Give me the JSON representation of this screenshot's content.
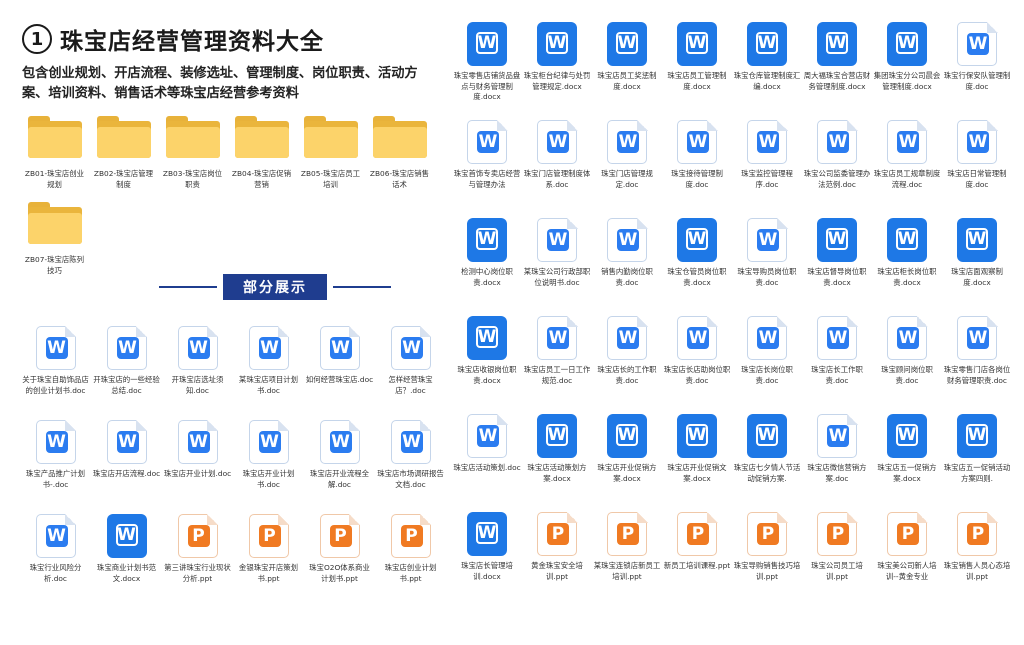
{
  "header": {
    "number": "1",
    "title": "珠宝店经营管理资料大全",
    "description": "包含创业规划、开店流程、装修选址、管理制度、岗位职责、活动方案、培训资料、销售话术等珠宝店经营参考资料"
  },
  "folders": [
    {
      "label": "ZB01-珠宝店创业规划"
    },
    {
      "label": "ZB02-珠宝店管理制度"
    },
    {
      "label": "ZB03-珠宝店岗位职责"
    },
    {
      "label": "ZB04-珠宝店促销营销"
    },
    {
      "label": "ZB05-珠宝店员工培训"
    },
    {
      "label": "ZB06-珠宝店销售话术"
    },
    {
      "label": "ZB07-珠宝店陈列技巧"
    }
  ],
  "section": {
    "label": "部分展示"
  },
  "left_files": [
    {
      "type": "wps",
      "label": "关于珠宝自助饰品店的创业计划书.doc"
    },
    {
      "type": "wps",
      "label": "开珠宝店的一些经验总结.doc"
    },
    {
      "type": "wps",
      "label": "开珠宝店选址须知.doc"
    },
    {
      "type": "wps",
      "label": "某珠宝店项目计划书.doc"
    },
    {
      "type": "wps",
      "label": "如何经营珠宝店.doc"
    },
    {
      "type": "wps",
      "label": "怎样经营珠宝店？.doc"
    },
    {
      "type": "wps",
      "label": "珠宝产品推广计划书-.doc"
    },
    {
      "type": "wps",
      "label": "珠宝店开店流程.doc"
    },
    {
      "type": "wps",
      "label": "珠宝店开业计划.doc"
    },
    {
      "type": "wps",
      "label": "珠宝店开业计划书.doc"
    },
    {
      "type": "wps",
      "label": "珠宝店开业流程全解.doc"
    },
    {
      "type": "wps",
      "label": "珠宝店市场调研报告文档.doc"
    },
    {
      "type": "wps",
      "label": "珠宝行业风险分析.doc"
    },
    {
      "type": "word",
      "label": "珠宝商业计划书范文.docx"
    },
    {
      "type": "ppt",
      "label": "第三讲珠宝行业现状分析.ppt"
    },
    {
      "type": "ppt",
      "label": "金银珠宝开店策划书.ppt"
    },
    {
      "type": "ppt",
      "label": "珠宝O2O体系商业计划书.ppt"
    },
    {
      "type": "ppt",
      "label": "珠宝店创业计划书.ppt"
    }
  ],
  "right_files": [
    {
      "type": "word",
      "label": "珠宝零售店铺货品盘点与财务管理制度.docx"
    },
    {
      "type": "word",
      "label": "珠宝柜台纪律与处罚管理规定.docx"
    },
    {
      "type": "word",
      "label": "珠宝店员工奖惩制度.docx"
    },
    {
      "type": "word",
      "label": "珠宝店员工管理制度.docx"
    },
    {
      "type": "word",
      "label": "珠宝仓库管理制度汇编.docx"
    },
    {
      "type": "word",
      "label": "周大福珠宝合营店财务管理制度.docx"
    },
    {
      "type": "word",
      "label": "集团珠宝分公司晨会管理制度.docx"
    },
    {
      "type": "wps",
      "label": "珠宝行保安队管理制度.doc"
    },
    {
      "type": "wps",
      "label": "珠宝首饰专卖店经营与管理办法"
    },
    {
      "type": "wps",
      "label": "珠宝门店管理制度体系.doc"
    },
    {
      "type": "wps",
      "label": "珠宝门店管理规定.doc"
    },
    {
      "type": "wps",
      "label": "珠宝接待管理制度.doc"
    },
    {
      "type": "wps",
      "label": "珠宝监控管理程序.doc"
    },
    {
      "type": "wps",
      "label": "珠宝公司监委管理办法范例.doc"
    },
    {
      "type": "wps",
      "label": "珠宝店员工规章制度流程.doc"
    },
    {
      "type": "wps",
      "label": "珠宝店日常管理制度.doc"
    },
    {
      "type": "word",
      "label": "检测中心岗位职责.docx"
    },
    {
      "type": "wps",
      "label": "某珠宝公司行政部职位说明书.doc"
    },
    {
      "type": "wps",
      "label": "销售内勤岗位职责.doc"
    },
    {
      "type": "word",
      "label": "珠宝仓管员岗位职责.docx"
    },
    {
      "type": "wps",
      "label": "珠宝导购员岗位职责.doc"
    },
    {
      "type": "word",
      "label": "珠宝店督导岗位职责.docx"
    },
    {
      "type": "word",
      "label": "珠宝店柜长岗位职责.docx"
    },
    {
      "type": "word",
      "label": "珠宝店面观察制度.docx"
    },
    {
      "type": "word",
      "label": "珠宝店收银岗位职责.docx"
    },
    {
      "type": "wps",
      "label": "珠宝店员工一日工作规范.doc"
    },
    {
      "type": "wps",
      "label": "珠宝店长的工作职责.doc"
    },
    {
      "type": "wps",
      "label": "珠宝店长店助岗位职责.doc"
    },
    {
      "type": "wps",
      "label": "珠宝店长岗位职责.doc"
    },
    {
      "type": "wps",
      "label": "珠宝店长工作职责.doc"
    },
    {
      "type": "wps",
      "label": "珠宝顾问岗位职责.doc"
    },
    {
      "type": "wps",
      "label": "珠宝零售门店各岗位财务管理职责.doc"
    },
    {
      "type": "wps",
      "label": "珠宝店活动策划.doc"
    },
    {
      "type": "word",
      "label": "珠宝店活动策划方案.docx"
    },
    {
      "type": "word",
      "label": "珠宝店开业促销方案.docx"
    },
    {
      "type": "word",
      "label": "珠宝店开业促销文案.docx"
    },
    {
      "type": "word",
      "label": "珠宝店七夕情人节活动促销方案."
    },
    {
      "type": "wps",
      "label": "珠宝店微信营销方案.doc"
    },
    {
      "type": "word",
      "label": "珠宝店五一促销方案.docx"
    },
    {
      "type": "word",
      "label": "珠宝店五一促销活动方案四则."
    },
    {
      "type": "word",
      "label": "珠宝店长管理培训.docx"
    },
    {
      "type": "ppt",
      "label": "黄金珠宝安全培训.ppt"
    },
    {
      "type": "ppt",
      "label": "某珠宝连锁店新员工培训.ppt"
    },
    {
      "type": "ppt",
      "label": "新员工培训课程.ppt"
    },
    {
      "type": "ppt",
      "label": "珠宝导购销售技巧培训.ppt"
    },
    {
      "type": "ppt",
      "label": "珠宝公司员工培训.ppt"
    },
    {
      "type": "ppt",
      "label": "珠宝美公司新人培训--黄金专业"
    },
    {
      "type": "ppt",
      "label": "珠宝销售人员心态培训.ppt"
    }
  ],
  "icons": {
    "wps": "W",
    "word": "W",
    "ppt": "P"
  },
  "colors": {
    "accent_blue": "#1f3d8f",
    "word_blue": "#1e78e6",
    "ppt_orange": "#f07a22",
    "folder_yellow": "#fcd36a"
  }
}
